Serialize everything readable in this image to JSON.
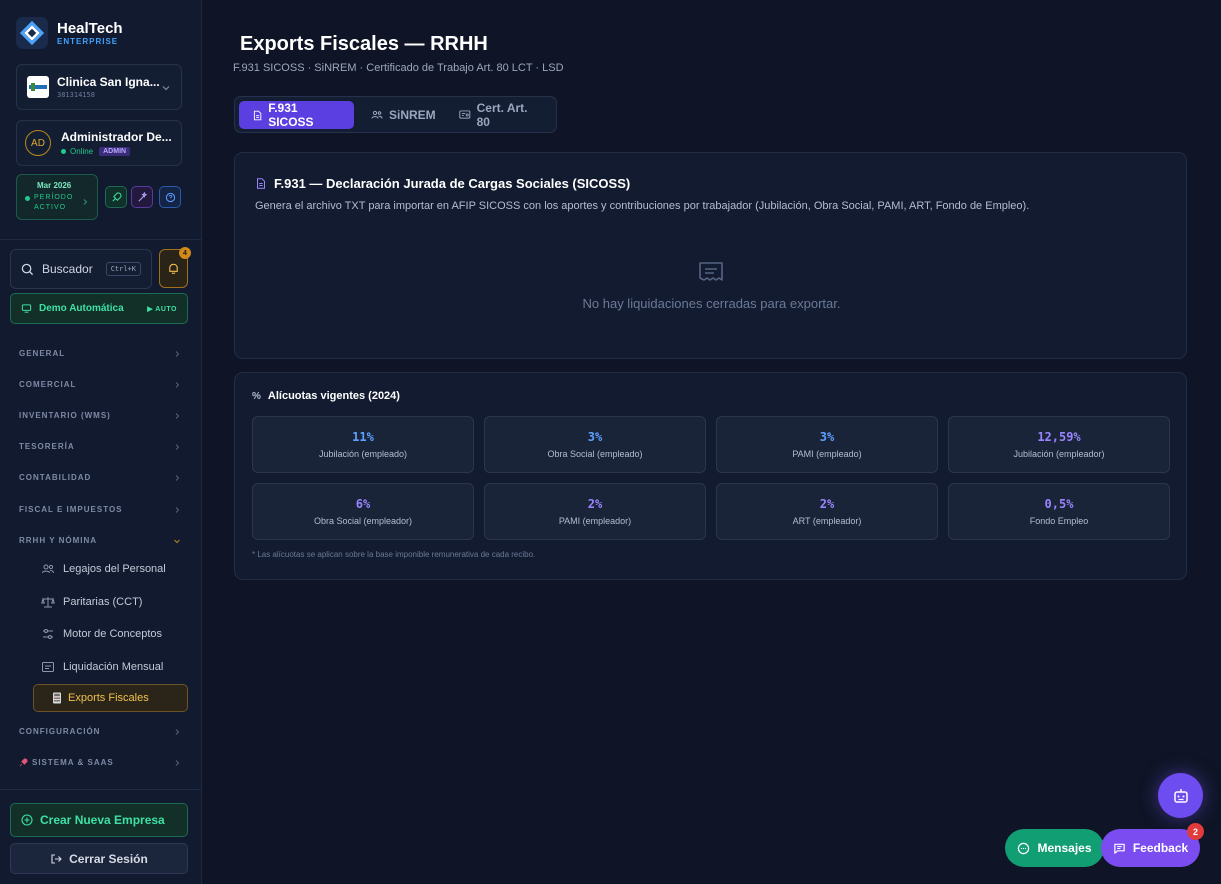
{
  "brand": {
    "name": "HealTech",
    "tier": "ENTERPRISE"
  },
  "company": {
    "name": "Clinica San Igna...",
    "id": "381314158"
  },
  "user": {
    "name": "Administrador De...",
    "status": "Online",
    "role": "ADMIN",
    "initials": "AD"
  },
  "period": {
    "month": "Mar 2026",
    "status": "PERÍODO ACTIVO"
  },
  "search": {
    "label": "Buscador",
    "shortcut": "Ctrl+K"
  },
  "notifications": {
    "count": "4"
  },
  "demo": {
    "label": "Demo Automática",
    "mode": "▶ AUTO"
  },
  "nav": {
    "sections": [
      {
        "label": "GENERAL"
      },
      {
        "label": "COMERCIAL"
      },
      {
        "label": "INVENTARIO (WMS)"
      },
      {
        "label": "TESORERÍA"
      },
      {
        "label": "CONTABILIDAD"
      },
      {
        "label": "FISCAL E IMPUESTOS"
      },
      {
        "label": "RRHH Y NÓMINA"
      },
      {
        "label": "CONFIGURACIÓN"
      },
      {
        "label": "SISTEMA & SAAS"
      }
    ],
    "rrhh_items": [
      {
        "label": "Legajos del Personal"
      },
      {
        "label": "Paritarias (CCT)"
      },
      {
        "label": "Motor de Conceptos"
      },
      {
        "label": "Liquidación Mensual"
      },
      {
        "label": "Exports Fiscales"
      }
    ]
  },
  "footer": {
    "create_label": "Crear Nueva Empresa",
    "logout_label": "Cerrar Sesión"
  },
  "page": {
    "title": "Exports Fiscales — RRHH",
    "subtitle": "F.931 SICOSS · SiNREM · Certificado de Trabajo Art. 80 LCT · LSD"
  },
  "tabs": [
    {
      "label": "F.931 SICOSS"
    },
    {
      "label": "SiNREM"
    },
    {
      "label": "Cert. Art. 80"
    }
  ],
  "f931": {
    "title": "F.931 — Declaración Jurada de Cargas Sociales (SICOSS)",
    "description": "Genera el archivo TXT para importar en AFIP SICOSS con los aportes y contribuciones por trabajador (Jubilación, Obra Social, PAMI, ART, Fondo de Empleo).",
    "empty_message": "No hay liquidaciones cerradas para exportar."
  },
  "rates": {
    "title": "Alícuotas vigentes (2024)",
    "items": [
      {
        "value": "11%",
        "label": "Jubilación (empleado)",
        "color": "#5fa0ff"
      },
      {
        "value": "3%",
        "label": "Obra Social (empleado)",
        "color": "#5fa0ff"
      },
      {
        "value": "3%",
        "label": "PAMI (empleado)",
        "color": "#5fa0ff"
      },
      {
        "value": "12,59%",
        "label": "Jubilación (empleador)",
        "color": "#9a85ff"
      },
      {
        "value": "6%",
        "label": "Obra Social (empleador)",
        "color": "#9a85ff"
      },
      {
        "value": "2%",
        "label": "PAMI (empleador)",
        "color": "#9a85ff"
      },
      {
        "value": "2%",
        "label": "ART (empleador)",
        "color": "#9a85ff"
      },
      {
        "value": "0,5%",
        "label": "Fondo Empleo",
        "color": "#9a85ff"
      }
    ],
    "note": "* Las alícuotas se aplican sobre la base imponible remunerativa de cada recibo."
  },
  "floating": {
    "messages_label": "Mensajes",
    "feedback_label": "Feedback",
    "feedback_count": "2"
  }
}
